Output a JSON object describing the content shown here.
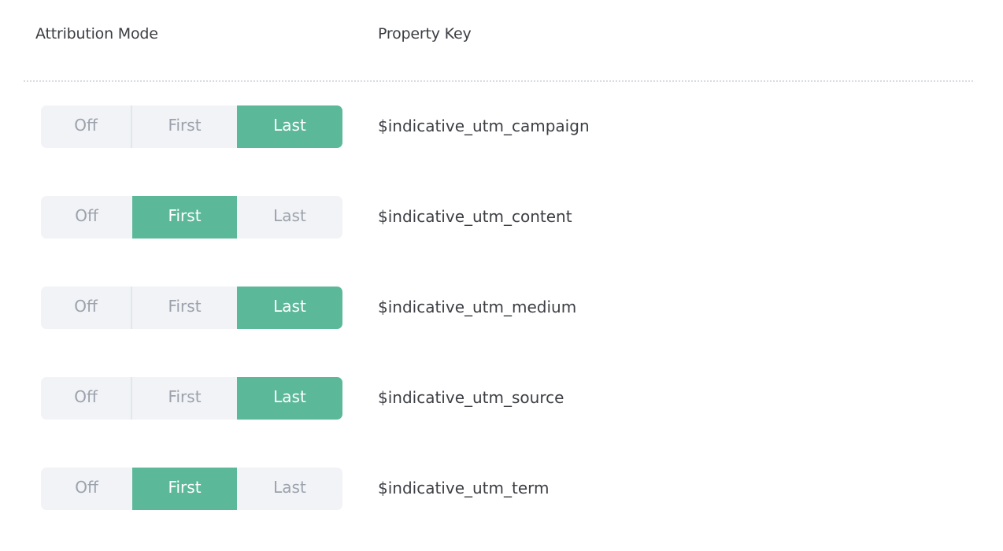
{
  "header": {
    "attribution_mode": "Attribution Mode",
    "property_key": "Property Key"
  },
  "options": [
    "Off",
    "First",
    "Last"
  ],
  "colors": {
    "active": "#5bb898",
    "inactive_bg": "#f1f3f6",
    "inactive_text": "#9ca2ad"
  },
  "rows": [
    {
      "key": "$indicative_utm_campaign",
      "selected": "Last"
    },
    {
      "key": "$indicative_utm_content",
      "selected": "First"
    },
    {
      "key": "$indicative_utm_medium",
      "selected": "Last"
    },
    {
      "key": "$indicative_utm_source",
      "selected": "Last"
    },
    {
      "key": "$indicative_utm_term",
      "selected": "First"
    }
  ]
}
